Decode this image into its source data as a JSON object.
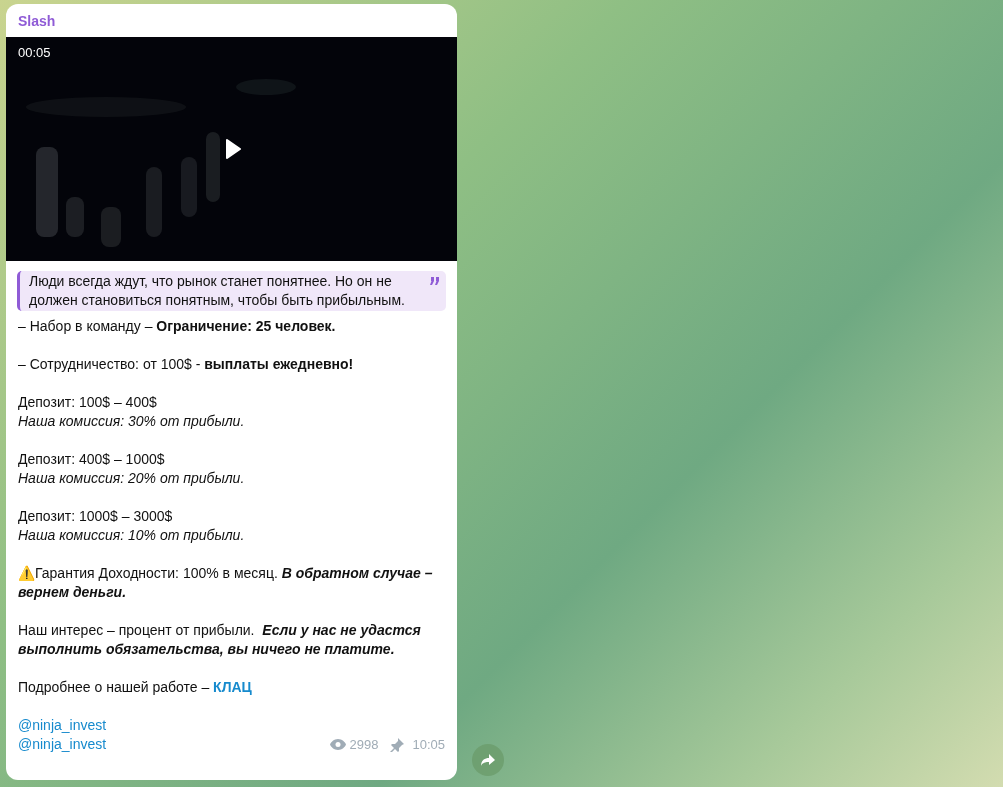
{
  "message": {
    "sender": "Slash",
    "video": {
      "kind": "picture",
      "duration": "00:05"
    },
    "quote": "Люди всегда ждут, что рынок станет понятнее. Но он не должен становиться понятным, чтобы быть прибыльным.",
    "paragraphs": [
      {
        "lines": [
          "– Набор в команду – **Ограничение: 25 человек.**"
        ]
      },
      {
        "lines": [
          "– Сотрудничество: от 100$ - **выплаты ежедневно!**"
        ]
      },
      {
        "lines": [
          "Депозит: 100$ – 400$",
          "*Наша комиссия: 30% от прибыли.*"
        ]
      },
      {
        "lines": [
          "Депозит: 400$ – 1000$",
          "*Наша комиссия: 20% от прибыли.*"
        ]
      },
      {
        "lines": [
          "Депозит: 1000$ – 3000$",
          "*Наша комиссия: 10% от прибыли.*"
        ]
      },
      {
        "lines": [
          "⚠️Гарантия Доходности: 100% в месяц. "
        ],
        "bold_italic": "В обратном случае – вернем деньги."
      },
      {
        "lines": [
          "Наш интерес – процент от прибыли.  "
        ],
        "bold_italic": "Если у нас не удастся выполнить обязательства, вы ничего не платите."
      },
      {
        "lines": [
          "Подробнее о нашей работе – "
        ],
        "link": "КЛАЦ"
      }
    ],
    "handles": [
      "@ninja_invest",
      "@ninja_invest"
    ],
    "views": "2998",
    "pinned": true,
    "time": "10:05"
  }
}
